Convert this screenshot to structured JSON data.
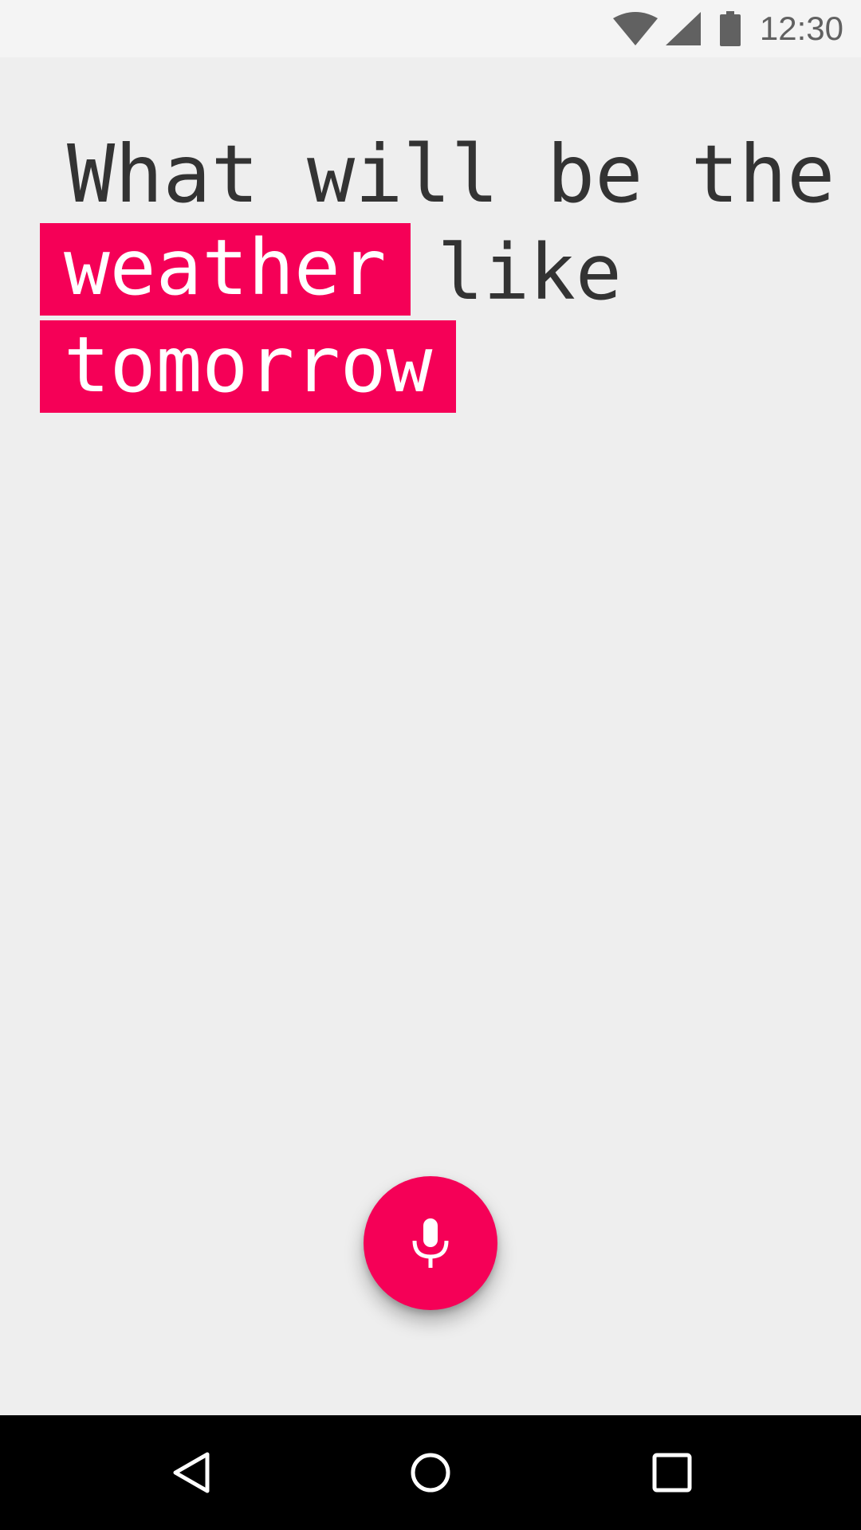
{
  "status_bar": {
    "time": "12:30",
    "icons": [
      "wifi-icon",
      "signal-icon",
      "battery-icon"
    ],
    "icon_color": "#616161"
  },
  "query": {
    "line1": "What will be the",
    "highlight_1": "weather",
    "plain_2": "like",
    "highlight_2": "tomorrow"
  },
  "colors": {
    "accent": "#f50057",
    "background": "#eeeeee",
    "text": "#333333",
    "nav_bar": "#000000"
  },
  "mic_button": {
    "icon": "microphone-icon"
  },
  "nav_bar": {
    "buttons": [
      "back-icon",
      "home-icon",
      "recents-icon"
    ]
  }
}
